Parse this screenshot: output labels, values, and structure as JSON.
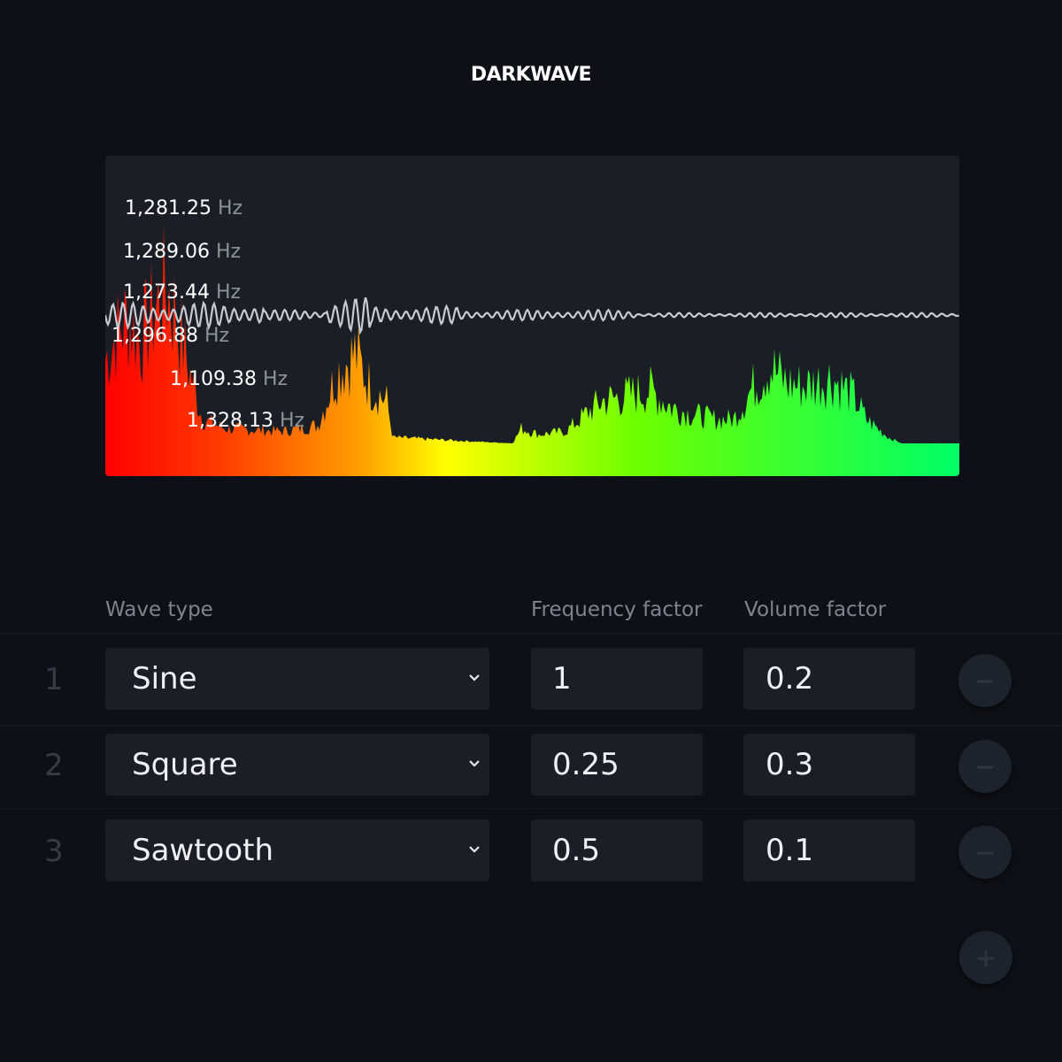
{
  "app": {
    "title": "DARKWAVE"
  },
  "visualizer": {
    "frequency_labels": [
      {
        "value": "1,281.25",
        "unit": "Hz"
      },
      {
        "value": "1,289.06",
        "unit": "Hz"
      },
      {
        "value": "1,273.44",
        "unit": "Hz"
      },
      {
        "value": "1,296.88",
        "unit": "Hz"
      },
      {
        "value": "1,109.38",
        "unit": "Hz"
      },
      {
        "value": "1,328.13",
        "unit": "Hz"
      }
    ],
    "gradient_colors": [
      "#ff0000",
      "#ff7a00",
      "#ffff00",
      "#6dff00",
      "#00ff66"
    ],
    "waveform_color": "#c8ccd2"
  },
  "table": {
    "headers": {
      "wave_type": "Wave type",
      "frequency_factor": "Frequency factor",
      "volume_factor": "Volume factor"
    },
    "rows": [
      {
        "index": "1",
        "wave_type": "Sine",
        "frequency": "1",
        "volume": "0.2",
        "remove_icon": "minus-icon"
      },
      {
        "index": "2",
        "wave_type": "Square",
        "frequency": "0.25",
        "volume": "0.3",
        "remove_icon": "minus-icon"
      },
      {
        "index": "3",
        "wave_type": "Sawtooth",
        "frequency": "0.5",
        "volume": "0.1",
        "remove_icon": "minus-icon"
      }
    ],
    "add_icon": "plus-icon"
  }
}
